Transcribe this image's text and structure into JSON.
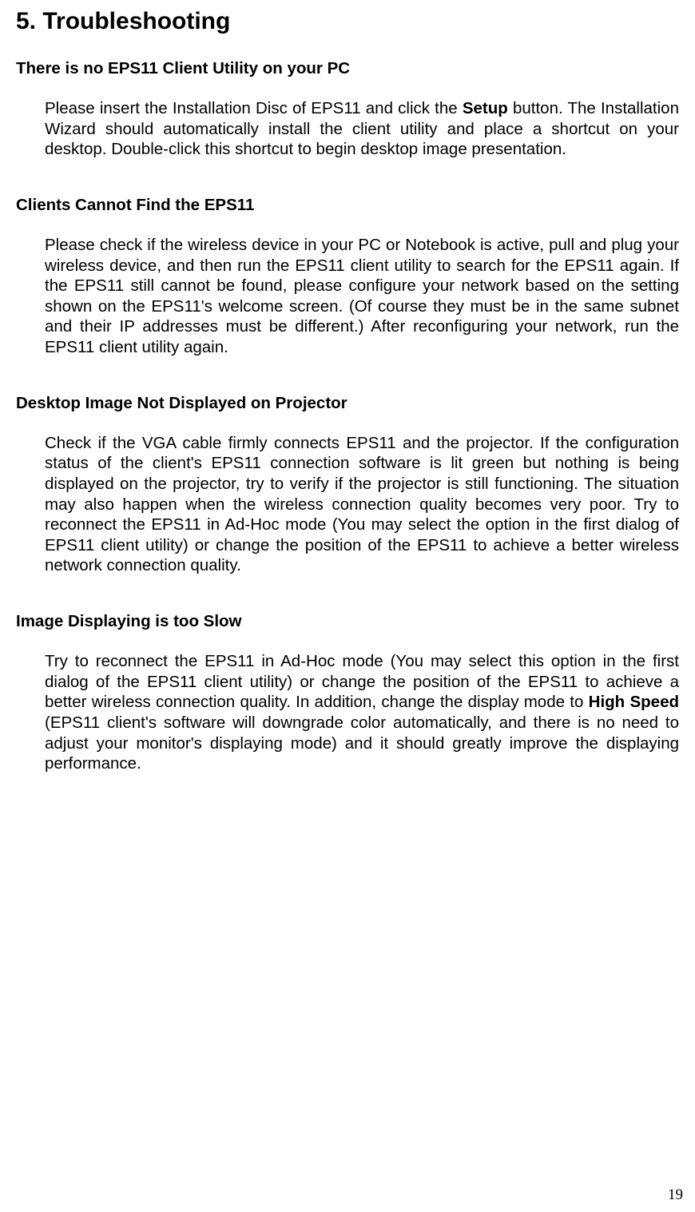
{
  "title": "5. Troubleshooting",
  "sections": [
    {
      "heading": "There is no EPS11 Client Utility on your PC",
      "body_pre": "Please insert the Installation Disc of EPS11 and click the ",
      "body_bold": "Setup",
      "body_post": " button. The Installation Wizard should automatically install the client utility and place a shortcut on your desktop. Double-click this shortcut to begin desktop image presentation."
    },
    {
      "heading": "Clients Cannot Find the EPS11",
      "body": "Please check if the wireless device in your PC or Notebook is active, pull and plug your wireless device, and then run the EPS11 client utility to search for the EPS11 again. If the EPS11 still cannot be found, please configure your network based on the setting shown on the EPS11's welcome screen. (Of course they must be in the same subnet and their IP addresses must be different.) After reconfiguring your network, run the EPS11 client utility again."
    },
    {
      "heading": "Desktop Image Not Displayed on Projector",
      "body": "Check if the VGA cable firmly connects EPS11 and the projector. If the configuration status of the client's EPS11 connection software is lit green but nothing is being displayed on the projector, try to verify if the projector is still functioning. The situation may also happen when the wireless connection quality becomes very poor. Try to reconnect the EPS11 in Ad-Hoc mode (You may select the option in the first dialog of EPS11 client utility) or change the position of the EPS11 to achieve a better wireless network connection quality."
    },
    {
      "heading": "Image Displaying is too Slow",
      "body_pre": "Try to reconnect the EPS11 in Ad-Hoc mode (You may select this option in the first dialog of the EPS11 client utility) or change the position of the EPS11 to achieve a better wireless connection quality. In addition, change the display mode to ",
      "body_bold": "High Speed",
      "body_post": " (EPS11 client's software will downgrade color automatically, and there is no need to adjust your monitor's displaying mode) and it should greatly improve the displaying performance."
    }
  ],
  "page_number": "19"
}
